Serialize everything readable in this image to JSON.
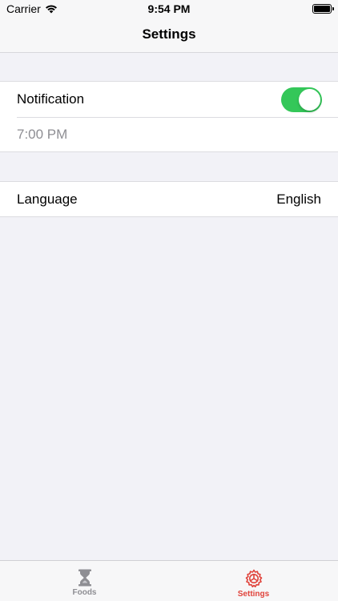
{
  "status_bar": {
    "carrier": "Carrier",
    "time": "9:54 PM"
  },
  "nav": {
    "title": "Settings"
  },
  "settings": {
    "notification_label": "Notification",
    "notification_enabled": true,
    "notification_time": "7:00 PM",
    "language_label": "Language",
    "language_value": "English"
  },
  "tab_bar": {
    "tabs": [
      {
        "label": "Foods",
        "icon": "hourglass-icon",
        "selected": false
      },
      {
        "label": "Settings",
        "icon": "settings-gear-icon",
        "selected": true
      }
    ]
  },
  "colors": {
    "toggle_on": "#34c759",
    "accent": "#e0433b",
    "background": "#f2f2f7",
    "secondary_text": "#8e8e93"
  }
}
